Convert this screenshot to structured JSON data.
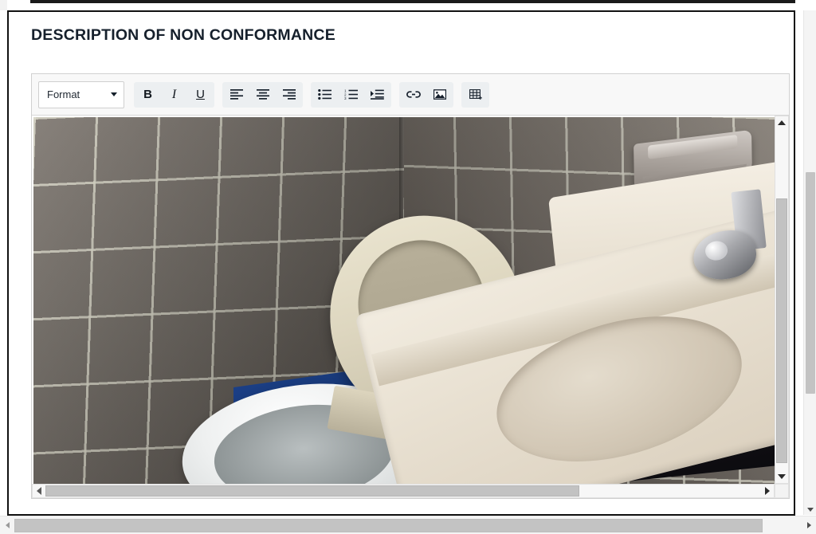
{
  "page": {
    "title": "DESCRIPTION OF NON CONFORMANCE"
  },
  "editor": {
    "toolbar": {
      "format_select": {
        "label": "Format",
        "caret_icon": "chevron-down-icon"
      },
      "groups": [
        {
          "name": "text-style",
          "buttons": [
            {
              "name": "bold-button",
              "label": "B",
              "icon": "bold-icon"
            },
            {
              "name": "italic-button",
              "label": "I",
              "icon": "italic-icon"
            },
            {
              "name": "underline-button",
              "label": "U",
              "icon": "underline-icon"
            }
          ]
        },
        {
          "name": "alignment",
          "buttons": [
            {
              "name": "align-left-button",
              "label": "",
              "icon": "align-left-icon"
            },
            {
              "name": "align-center-button",
              "label": "",
              "icon": "align-center-icon"
            },
            {
              "name": "align-right-button",
              "label": "",
              "icon": "align-right-icon"
            }
          ]
        },
        {
          "name": "lists",
          "buttons": [
            {
              "name": "bulleted-list-button",
              "label": "",
              "icon": "bulleted-list-icon"
            },
            {
              "name": "numbered-list-button",
              "label": "",
              "icon": "numbered-list-icon"
            },
            {
              "name": "increase-indent-button",
              "label": "",
              "icon": "indent-icon"
            }
          ]
        },
        {
          "name": "insert",
          "buttons": [
            {
              "name": "insert-link-button",
              "label": "",
              "icon": "link-icon"
            },
            {
              "name": "insert-image-button",
              "label": "",
              "icon": "image-icon"
            }
          ]
        },
        {
          "name": "table",
          "buttons": [
            {
              "name": "insert-table-button",
              "label": "",
              "icon": "table-icon"
            }
          ]
        }
      ]
    },
    "content": {
      "type": "image",
      "description": "Photograph of a bathroom showing a grey tiled wall, a white toilet with a raised beige seat lid pressed against a dark vanity cabinet, and a cream coloured sink countertop with a chrome faucet. A grey soap dish is mounted on the tile above the sink and a blue object is visible behind the toilet.",
      "alt_text": "Bathroom non conformance photo"
    },
    "scrollbars": {
      "vertical": {
        "name": "editor-vertical-scrollbar",
        "up_arrow_icon": "triangle-up-icon",
        "down_arrow_icon": "triangle-down-icon",
        "thumb_top_pct": 19,
        "thumb_height_pct": 72
      },
      "horizontal": {
        "name": "editor-horizontal-scrollbar",
        "left_arrow_icon": "triangle-left-icon",
        "right_arrow_icon": "triangle-right-icon",
        "thumb_left_pct": 0,
        "thumb_width_pct": 72
      }
    }
  },
  "browser": {
    "vertical_scrollbar": {
      "name": "page-vertical-scrollbar",
      "down_arrow_icon": "triangle-down-icon",
      "thumb_top_pct": 32,
      "thumb_height_pct": 44
    },
    "horizontal_scrollbar": {
      "name": "page-horizontal-scrollbar",
      "left_arrow_icon": "triangle-left-icon",
      "right_arrow_icon": "triangle-right-icon",
      "thumb_left_pct": 0,
      "thumb_width_pct": 95
    }
  },
  "colors": {
    "panel_border": "#111111",
    "title_text": "#16202c",
    "toolbar_bg": "#f8f8f8",
    "group_bg": "#eceff1",
    "editor_border": "#d1d1d1",
    "scrollbar_thumb": "#c2c2c2"
  }
}
